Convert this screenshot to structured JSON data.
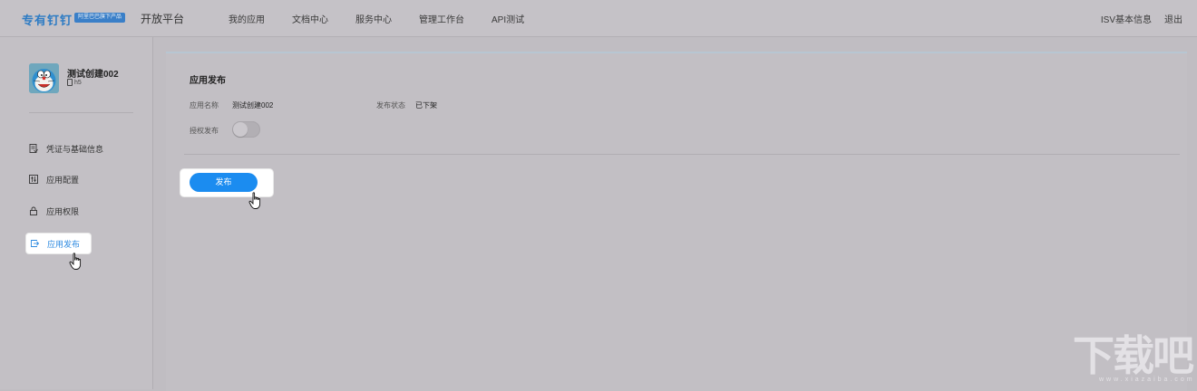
{
  "header": {
    "logo_text": "专有钉钉",
    "logo_badge": "阿里巴巴旗下产品",
    "platform_title": "开放平台",
    "nav_items": [
      "我的应用",
      "文档中心",
      "服务中心",
      "管理工作台",
      "API测试"
    ],
    "right_links": [
      "ISV基本信息",
      "退出"
    ]
  },
  "app": {
    "name": "测试创建002",
    "type": "h5",
    "avatar_icon": "doraemon-avatar"
  },
  "sidebar": {
    "items": [
      {
        "label": "凭证与基础信息",
        "icon": "credential-icon"
      },
      {
        "label": "应用配置",
        "icon": "config-icon"
      },
      {
        "label": "应用权限",
        "icon": "lock-icon"
      },
      {
        "label": "应用发布",
        "icon": "publish-icon",
        "active": true
      }
    ]
  },
  "main": {
    "section_title": "应用发布",
    "fields": {
      "app_name_label": "应用名称",
      "app_name_value": "测试创建002",
      "status_label": "发布状态",
      "status_value": "已下架",
      "auth_publish_label": "授权发布",
      "auth_publish_enabled": false
    },
    "publish_button": "发布"
  },
  "colors": {
    "accent": "#1b8cf0",
    "active_menu_text": "#2d8ae0",
    "logo": "#2d7bc4"
  },
  "watermark": {
    "text": "下载吧",
    "sub": "www.xiazaiba.com"
  }
}
